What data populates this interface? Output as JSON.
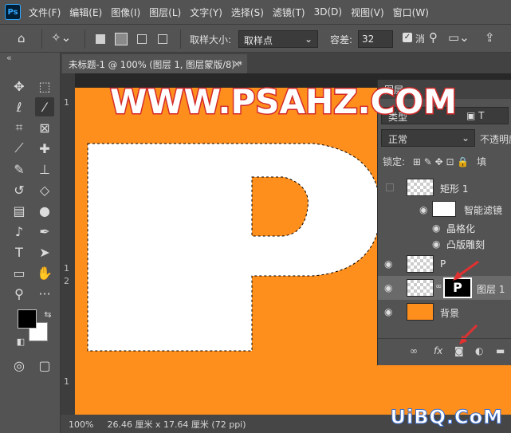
{
  "app": {
    "logo": "Ps"
  },
  "menu": [
    "文件(F)",
    "编辑(E)",
    "图像(I)",
    "图层(L)",
    "文字(Y)",
    "选择(S)",
    "滤镜(T)",
    "3D(D)",
    "视图(V)",
    "窗口(W)"
  ],
  "options": {
    "sample_size_label": "取样大小:",
    "sample_size_value": "取样点",
    "tolerance_label": "容差:",
    "tolerance_value": "32",
    "antialias_label": "消"
  },
  "document": {
    "tab_title": "未标题-1 @ 100% (图层 1, 图层蒙版/8) *",
    "close_glyph": "×",
    "canvas_color": "#ff8f1d",
    "letter": "P"
  },
  "rulers": {
    "v1": "1",
    "v2": "2",
    "v3": "1",
    "v4": "1"
  },
  "status": {
    "zoom": "100%",
    "doc_info": "26.46 厘米 x 17.64 厘米 (72 ppi)"
  },
  "layers_panel": {
    "tab_label": "图层",
    "filter_label": "类型",
    "blend_mode": "正常",
    "opacity_label": "不透明度",
    "lock_label": "锁定:",
    "fill_label": "填",
    "layers": [
      {
        "name": "矩形 1",
        "visible": false,
        "smart": true
      },
      {
        "name": "智能滤镜",
        "visible": true,
        "sub": true
      },
      {
        "name": "晶格化",
        "visible": true,
        "filter": true
      },
      {
        "name": "凸版雕刻",
        "visible": true,
        "filter": true
      },
      {
        "name": "P",
        "visible": true
      },
      {
        "name": "图层 1",
        "visible": true,
        "selected": true,
        "has_mask": true
      },
      {
        "name": "背景",
        "visible": true,
        "color": "#ff8f1d"
      }
    ]
  },
  "watermarks": {
    "top": "WWW.PSAHZ.COM",
    "bottom": "UiBQ.CoM"
  },
  "colors": {
    "accent_red": "#e03131",
    "orange": "#ff8f1d"
  }
}
